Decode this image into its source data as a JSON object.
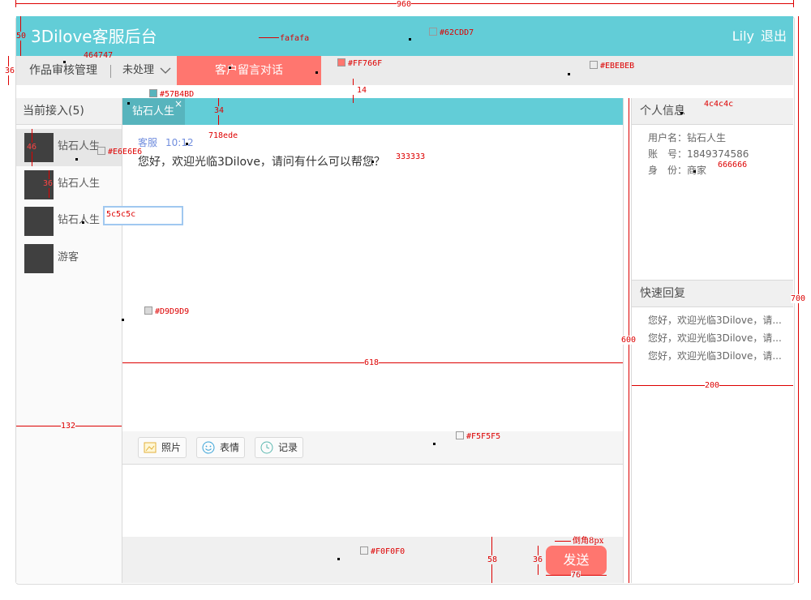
{
  "header": {
    "title": "3Dilove客服后台",
    "user": "Lily",
    "logout": "退出"
  },
  "nav": {
    "review": "作品审核管理",
    "status": "未处理",
    "chat": "客户留言对话"
  },
  "left_panel": {
    "title": "当前接入(5)",
    "contacts": [
      {
        "name": "钻石人生"
      },
      {
        "name": "钻石人生"
      },
      {
        "name": "钻石人生"
      },
      {
        "name": "游客"
      }
    ]
  },
  "chat": {
    "tab_label": "钻石人生",
    "tab_close": "×",
    "message": {
      "sender": "客服",
      "time": "10:12",
      "text": "您好，欢迎光临3Dilove，请问有什么可以帮您？"
    },
    "tools": [
      {
        "label": "照片"
      },
      {
        "label": "表情"
      },
      {
        "label": "记录"
      }
    ],
    "send_label": "发送"
  },
  "profile": {
    "title": "个人信息",
    "rows": [
      "用户名：钻石人生",
      "账　号：1849374586",
      "身　份：商家"
    ]
  },
  "quick_reply": {
    "title": "快速回复",
    "items": [
      "您好，欢迎光临3Dilove，请...",
      "您好，欢迎光临3Dilove，请...",
      "您好，欢迎光临3Dilove，请..."
    ]
  },
  "colors": {
    "header": "#62CDD7",
    "nav_active": "#FF766F",
    "nav_bg": "#EBEBEB",
    "tab_active": "#57B4BD",
    "contact_active": "#E6E6E6",
    "border": "#D9D9D9",
    "toolbar": "#F5F5F5",
    "sendbar": "#F0F0F0"
  },
  "annotations": {
    "w_total": "960",
    "h_header": "50",
    "h_nav": "36",
    "c_text_nav": "464747",
    "c_header": "#62CDD7",
    "c_fafafa": "fafafa",
    "c_ff766f": "#FF766F",
    "c_ebebeb": "#EBEBEB",
    "gap_14": "14",
    "c_57b4bd": "#57B4BD",
    "h_tab": "34",
    "c_panel_title": "4c4c4c",
    "c_meta": "718ede",
    "c_msg": "333333",
    "c_e6e6e6": "#E6E6E6",
    "h_46": "46",
    "s_36": "36",
    "c_5c5c5c": "5c5c5c",
    "c_666666": "666666",
    "c_d9d9d9": "#D9D9D9",
    "w_618": "618",
    "h_600": "600",
    "h_700": "700",
    "w_200": "200",
    "w_132": "132",
    "c_f5f5f5": "#F5F5F5",
    "c_f0f0f0": "#F0F0F0",
    "h_58": "58",
    "h_36b": "36",
    "w_76": "76",
    "radius_note": "倒角8px"
  }
}
